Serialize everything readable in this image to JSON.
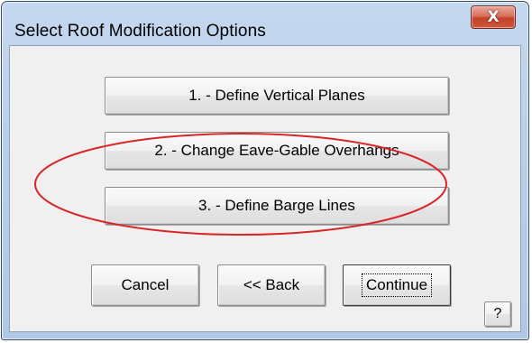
{
  "window": {
    "title": "Select Roof Modification Options",
    "close_glyph": "X"
  },
  "options": [
    {
      "label": "1. - Define Vertical Planes"
    },
    {
      "label": "2. - Change Eave-Gable Overhangs"
    },
    {
      "label": "3. - Define Barge Lines"
    }
  ],
  "footer": {
    "cancel_label": "Cancel",
    "back_label": "<< Back",
    "continue_label": "Continue",
    "help_label": "?"
  },
  "colors": {
    "highlight_ellipse": "#d9262a",
    "title_bar": "#b9d0ea",
    "close_button": "#c94a32"
  },
  "highlight": {
    "target": "option-3",
    "shape": "ellipse"
  }
}
